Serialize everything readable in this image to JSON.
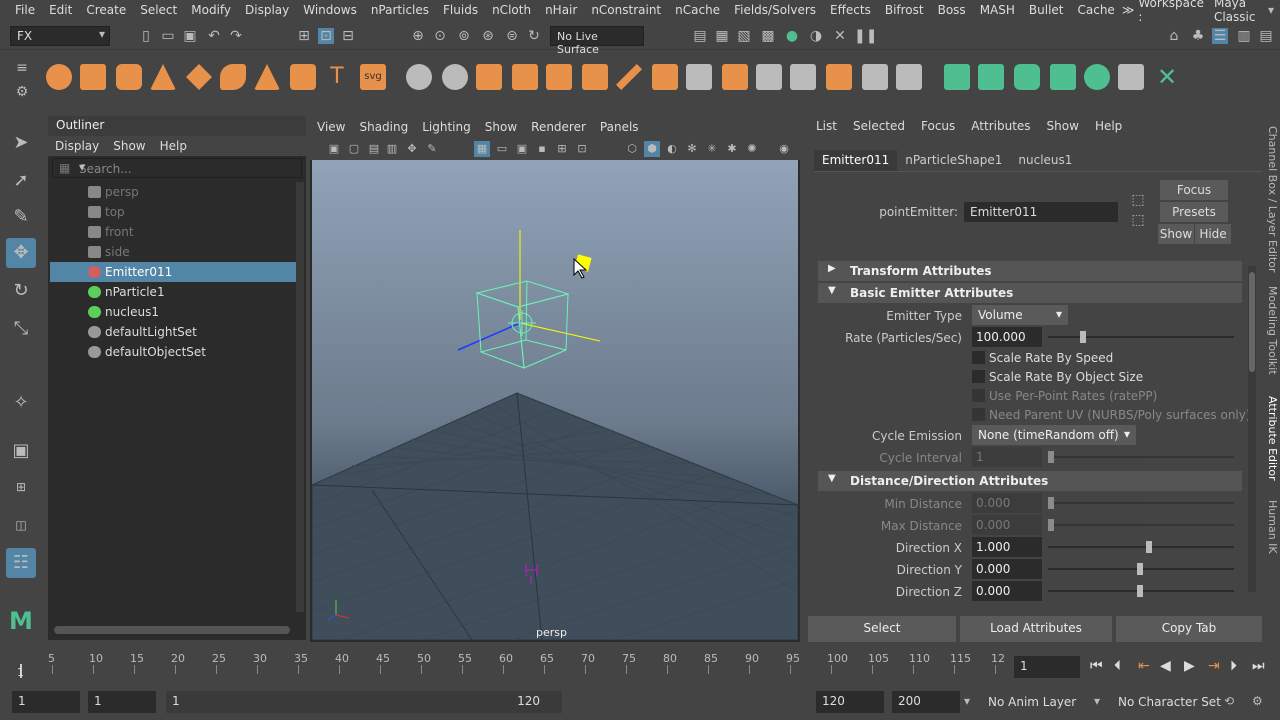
{
  "menubar": {
    "items": [
      "File",
      "Edit",
      "Create",
      "Select",
      "Modify",
      "Display",
      "Windows",
      "nParticles",
      "Fluids",
      "nCloth",
      "nHair",
      "nConstraint",
      "nCache",
      "Fields/Solvers",
      "Effects",
      "Bifrost",
      "Boss",
      "MASH",
      "Bullet",
      "Cache"
    ],
    "workspace_label": "Workspace :",
    "workspace_value": "Maya Classic",
    "overflow": "≫"
  },
  "statusline": {
    "menuset": "FX",
    "live_surface": "No Live Surface"
  },
  "outliner": {
    "title": "Outliner",
    "menu": [
      "Display",
      "Show",
      "Help"
    ],
    "search_placeholder": "Search...",
    "rows": [
      {
        "label": "persp",
        "icon": "camera-icon",
        "dim": true
      },
      {
        "label": "top",
        "icon": "camera-icon",
        "dim": true
      },
      {
        "label": "front",
        "icon": "camera-icon",
        "dim": true
      },
      {
        "label": "side",
        "icon": "camera-icon",
        "dim": true
      },
      {
        "label": "Emitter011",
        "icon": "emitter-icon",
        "selected": true
      },
      {
        "label": "nParticle1",
        "icon": "nparticle-icon"
      },
      {
        "label": "nucleus1",
        "icon": "nucleus-icon"
      },
      {
        "label": "defaultLightSet",
        "icon": "set-icon"
      },
      {
        "label": "defaultObjectSet",
        "icon": "set-icon"
      }
    ]
  },
  "viewport": {
    "menu": [
      "View",
      "Shading",
      "Lighting",
      "Show",
      "Renderer",
      "Panels"
    ],
    "camera_label": "persp"
  },
  "attribute_editor": {
    "menu": [
      "List",
      "Selected",
      "Focus",
      "Attributes",
      "Show",
      "Help"
    ],
    "tabs": [
      "Emitter011",
      "nParticleShape1",
      "nucleus1"
    ],
    "node_type_label": "pointEmitter:",
    "node_name": "Emitter011",
    "focus_label": "Focus",
    "presets_label": "Presets",
    "show_label": "Show",
    "hide_label": "Hide",
    "sections": {
      "transform": "Transform Attributes",
      "basic": "Basic Emitter Attributes",
      "distance": "Distance/Direction Attributes"
    },
    "emitter_type_label": "Emitter Type",
    "emitter_type_value": "Volume",
    "rate_label": "Rate (Particles/Sec)",
    "rate_value": "100.000",
    "checkboxes": [
      "Scale Rate By Speed",
      "Scale Rate By Object Size",
      "Use Per-Point Rates (ratePP)",
      "Need Parent UV (NURBS/Poly surfaces only)"
    ],
    "cycle_emission_label": "Cycle Emission",
    "cycle_emission_value": "None (timeRandom off)",
    "cycle_interval_label": "Cycle Interval",
    "cycle_interval_value": "1",
    "min_distance_label": "Min Distance",
    "min_distance_value": "0.000",
    "max_distance_label": "Max Distance",
    "max_distance_value": "0.000",
    "direction_x_label": "Direction X",
    "direction_x_value": "1.000",
    "direction_y_label": "Direction Y",
    "direction_y_value": "0.000",
    "direction_z_label": "Direction Z",
    "direction_z_value": "0.000",
    "buttons": {
      "select": "Select",
      "load": "Load Attributes",
      "copy": "Copy Tab"
    }
  },
  "side_tabs": [
    "Channel Box / Layer Editor",
    "Modeling Toolkit",
    "Attribute Editor",
    "Human IK"
  ],
  "timeline": {
    "ticks": [
      "5",
      "10",
      "15",
      "20",
      "25",
      "30",
      "35",
      "40",
      "45",
      "50",
      "55",
      "60",
      "65",
      "70",
      "75",
      "80",
      "85",
      "90",
      "95",
      "100",
      "105",
      "110",
      "115",
      "12"
    ],
    "start_marker": "1",
    "current_frame": "1"
  },
  "range": {
    "start": "1",
    "playback_start": "1",
    "slider_start": "1",
    "slider_end": "120",
    "playback_end": "120",
    "end": "200",
    "anim_layer": "No Anim Layer",
    "character_set": "No Character Set"
  },
  "colors": {
    "selection": "#5285a6",
    "shelf_orange": "#e8914a",
    "shelf_green": "#4fbf91"
  }
}
